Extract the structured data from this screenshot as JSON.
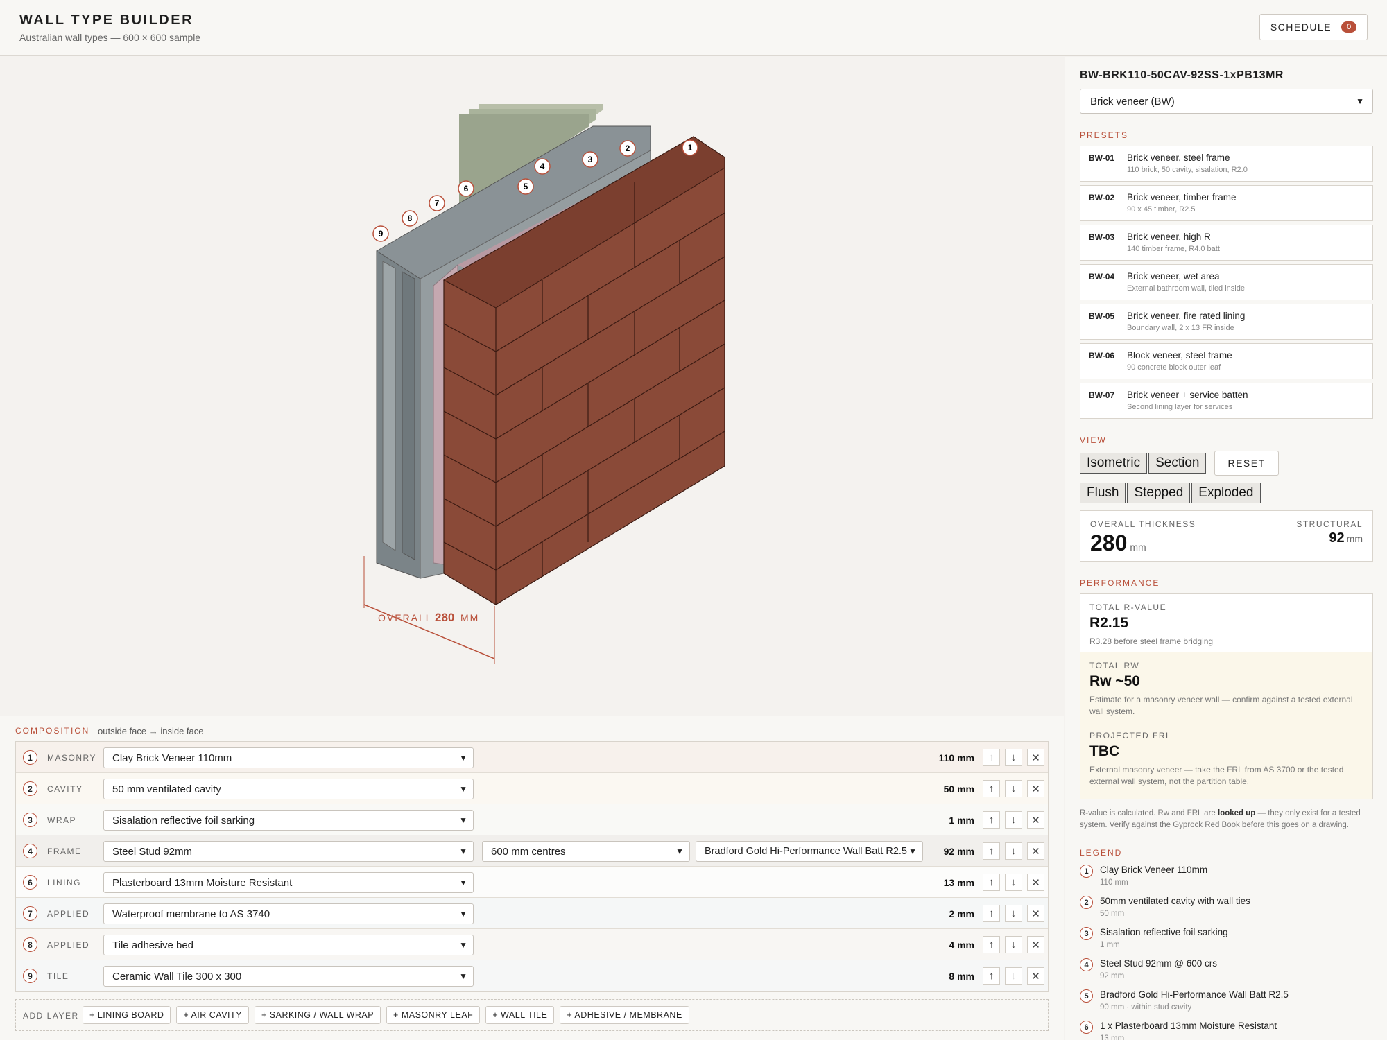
{
  "header": {
    "title": "WALL TYPE BUILDER",
    "subtitle": "Australian wall types — 600 × 600 sample",
    "schedule_label": "SCHEDULE",
    "schedule_count": "0"
  },
  "canvas": {
    "dimension_label": "OVERALL",
    "dimension_value": "280",
    "dimension_unit": "MM",
    "callouts": [
      "1",
      "2",
      "3",
      "4",
      "5",
      "6",
      "7",
      "8",
      "9"
    ],
    "colors": {
      "brick": "#8a4a38",
      "brick_top": "#7b3f2f",
      "brick_side": "#703828",
      "stud": "#7e868a",
      "insulation": "#c5a8b0",
      "accent": "#b9503a"
    }
  },
  "sidebar": {
    "wall_code": "BW-BRK110-50CAV-92SS-1xPB13MR",
    "wall_type": "Brick veneer (BW)",
    "presets_label": "PRESETS",
    "presets": [
      {
        "id": "BW-01",
        "name": "Brick veneer, steel frame",
        "desc": "110 brick, 50 cavity, sisalation, R2.0"
      },
      {
        "id": "BW-02",
        "name": "Brick veneer, timber frame",
        "desc": "90 x 45 timber, R2.5"
      },
      {
        "id": "BW-03",
        "name": "Brick veneer, high R",
        "desc": "140 timber frame, R4.0 batt"
      },
      {
        "id": "BW-04",
        "name": "Brick veneer, wet area",
        "desc": "External bathroom wall, tiled inside"
      },
      {
        "id": "BW-05",
        "name": "Brick veneer, fire rated lining",
        "desc": "Boundary wall, 2 x 13 FR inside"
      },
      {
        "id": "BW-06",
        "name": "Block veneer, steel frame",
        "desc": "90 concrete block outer leaf"
      },
      {
        "id": "BW-07",
        "name": "Brick veneer + service batten",
        "desc": "Second lining layer for services"
      }
    ],
    "view_label": "VIEW",
    "view_modes": [
      "Isometric",
      "Section"
    ],
    "reset_label": "RESET",
    "layout_modes": [
      "Flush",
      "Stepped",
      "Exploded"
    ],
    "thickness": {
      "label": "OVERALL THICKNESS",
      "value": "280",
      "unit": "mm",
      "struct_label": "STRUCTURAL",
      "struct_value": "92",
      "struct_unit": "mm"
    },
    "performance_label": "PERFORMANCE",
    "performance": {
      "r_label": "TOTAL R-VALUE",
      "r_value": "R2.15",
      "r_note": "R3.28 before steel frame bridging",
      "rw_label": "TOTAL RW",
      "rw_value": "Rw ~50",
      "rw_note": "Estimate for a masonry veneer wall — confirm against a tested external wall system.",
      "frl_label": "PROJECTED FRL",
      "frl_value": "TBC",
      "frl_note": "External masonry veneer — take the FRL from AS 3700 or the tested external wall system, not the partition table."
    },
    "disclaimer": {
      "part1": "R-value is calculated. Rw and FRL are ",
      "bold": "looked up",
      "part2": " — they only exist for a tested system. Verify against the Gyprock Red Book before this goes on a drawing."
    },
    "legend_label": "LEGEND",
    "legend": [
      {
        "num": "1",
        "name": "Clay Brick Veneer 110mm",
        "sub": "110 mm"
      },
      {
        "num": "2",
        "name": "50mm ventilated cavity with wall ties",
        "sub": "50 mm"
      },
      {
        "num": "3",
        "name": "Sisalation reflective foil sarking",
        "sub": "1 mm"
      },
      {
        "num": "4",
        "name": "Steel Stud 92mm @ 600 crs",
        "sub": "92 mm"
      },
      {
        "num": "5",
        "name": "Bradford Gold Hi-Performance Wall Batt R2.5",
        "sub": "90 mm · within stud cavity"
      },
      {
        "num": "6",
        "name": "1 x Plasterboard 13mm Moisture Resistant",
        "sub": "13 mm"
      }
    ]
  },
  "composition": {
    "label": "COMPOSITION",
    "sub": "outside face → inside face",
    "layers": [
      {
        "num": "1",
        "type": "MASONRY",
        "material": "Clay Brick Veneer 110mm",
        "thickness": "110 mm"
      },
      {
        "num": "2",
        "type": "CAVITY",
        "material": "50 mm ventilated cavity",
        "thickness": "50 mm"
      },
      {
        "num": "3",
        "type": "WRAP",
        "material": "Sisalation reflective foil sarking",
        "thickness": "1 mm"
      },
      {
        "num": "4",
        "type": "FRAME",
        "material": "Steel Stud 92mm",
        "spacing": "600 mm centres",
        "insulation": "Bradford Gold Hi-Performance Wall Batt R2.5",
        "thickness": "92 mm"
      },
      {
        "num": "6",
        "type": "LINING",
        "material": "Plasterboard 13mm Moisture Resistant",
        "thickness": "13 mm"
      },
      {
        "num": "7",
        "type": "APPLIED",
        "material": "Waterproof membrane to AS 3740",
        "thickness": "2 mm"
      },
      {
        "num": "8",
        "type": "APPLIED",
        "material": "Tile adhesive bed",
        "thickness": "4 mm"
      },
      {
        "num": "9",
        "type": "TILE",
        "material": "Ceramic Wall Tile 300 x 300",
        "thickness": "8 mm"
      }
    ],
    "add_label": "ADD LAYER",
    "add_buttons": [
      "+ LINING BOARD",
      "+ AIR CAVITY",
      "+ SARKING / WALL WRAP",
      "+ MASONRY LEAF",
      "+ WALL TILE",
      "+ ADHESIVE / MEMBRANE"
    ]
  }
}
